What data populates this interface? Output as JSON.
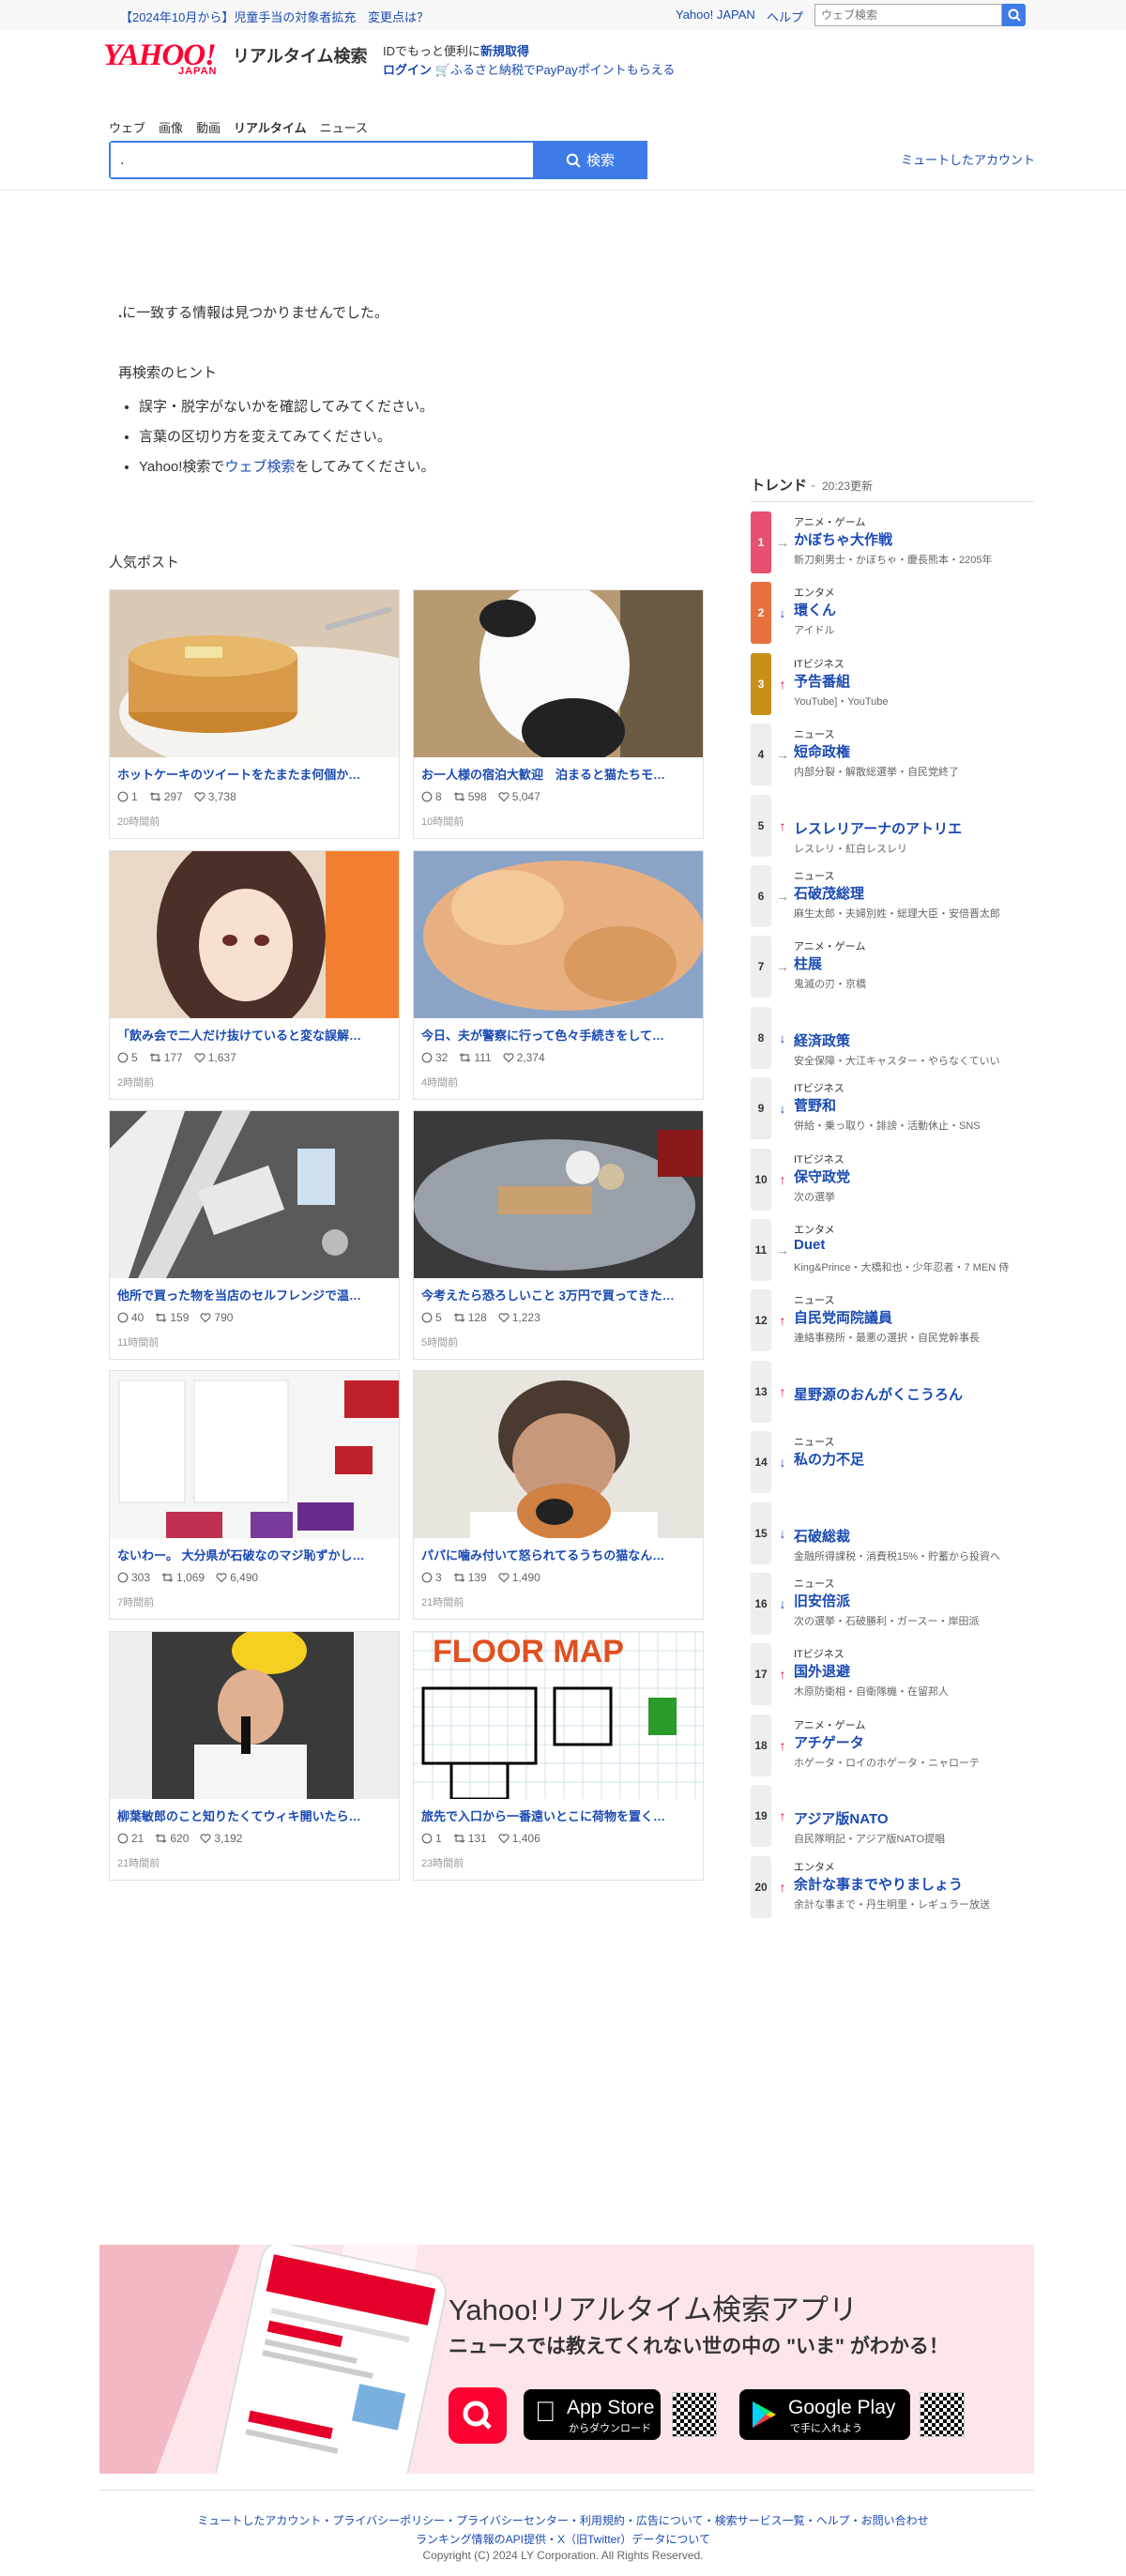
{
  "top_bar": {
    "notice": "【2024年10月から】児童手当の対象者拡充",
    "notice_link": "変更点は？",
    "yahoo_japan": "Yahoo! JAPAN",
    "help": "ヘルプ",
    "web_search_placeholder": "ウェブ検索"
  },
  "header": {
    "logo_text": "YAHOO!",
    "logo_sub": "JAPAN",
    "service_name": "リアルタイム検索",
    "login_text_prefix": "IDでもっと便利に",
    "signup": "新規取得",
    "login": "ログイン",
    "furusato": "ふるさと納税でPayPayポイントもらえる"
  },
  "tabs": [
    {
      "label": "ウェブ"
    },
    {
      "label": "画像"
    },
    {
      "label": "動画"
    },
    {
      "label": "リアルタイム",
      "active": true
    },
    {
      "label": "ニュース"
    }
  ],
  "search": {
    "query": ".",
    "button_label": "検索"
  },
  "muted_accounts": "ミュートしたアカウント",
  "no_result": {
    "query": ".",
    "message": "に一致する情報は見つかりませんでした。",
    "hint_title": "再検索のヒント",
    "hints": [
      "誤字・脱字がないかを確認してみてください。",
      "言葉の区切り方を変えてみてください。"
    ],
    "hint3_prefix": "Yahoo!検索で",
    "hint3_link": "ウェブ検索",
    "hint3_suffix": "をしてみてください。"
  },
  "popular": {
    "title": "人気ポスト",
    "posts": [
      {
        "title": "ホットケーキのツイートをたまたま何個か…",
        "replies": "1",
        "reposts": "297",
        "likes": "3,738",
        "time": "20時間前",
        "thumb": "pancake"
      },
      {
        "title": "お一人様の宿泊大歓迎　泊まると猫たちモ…",
        "replies": "8",
        "reposts": "598",
        "likes": "5,047",
        "time": "10時間前",
        "thumb": "cat-bw"
      },
      {
        "title": "「飲み会で二人だけ抜けていると変な誤解…",
        "replies": "5",
        "reposts": "177",
        "likes": "1,637",
        "time": "2時間前",
        "thumb": "anime"
      },
      {
        "title": "今日、夫が警察に行って色々手続きをして…",
        "replies": "32",
        "reposts": "111",
        "likes": "2,374",
        "time": "4時間前",
        "thumb": "cat-orange"
      },
      {
        "title": "他所で買った物を当店のセルフレンジで温…",
        "replies": "40",
        "reposts": "159",
        "likes": "790",
        "time": "11時間前",
        "thumb": "trash"
      },
      {
        "title": "今考えたら恐ろしいこと 3万円で買ってきた…",
        "replies": "5",
        "reposts": "128",
        "likes": "1,223",
        "time": "5時間前",
        "thumb": "car"
      },
      {
        "title": "ないわー。 大分県が石破なのマジ恥ずかし…",
        "replies": "303",
        "reposts": "1,069",
        "likes": "6,490",
        "time": "7時間前",
        "thumb": "map"
      },
      {
        "title": "パパに噛み付いて怒られてるうちの猫なん…",
        "replies": "3",
        "reposts": "139",
        "likes": "1,490",
        "time": "21時間前",
        "thumb": "man-cat"
      },
      {
        "title": "柳葉敏郎のこと知りたくてウィキ開いたら…",
        "replies": "21",
        "reposts": "620",
        "likes": "3,192",
        "time": "21時間前",
        "thumb": "baseball"
      },
      {
        "title": "旅先で入口から一番遠いとこに荷物を置く…",
        "replies": "1",
        "reposts": "131",
        "likes": "1,406",
        "time": "23時間前",
        "thumb": "floormap"
      }
    ]
  },
  "trends": {
    "title": "トレンド",
    "updated": "20:23更新",
    "items": [
      {
        "rank": "1",
        "dir": "flat",
        "category": "アニメ・ゲーム",
        "word": "かぼちゃ大作戦",
        "related": "新刀剣男士・かぼちゃ・慶長熊本・2205年",
        "color": "#e8506f"
      },
      {
        "rank": "2",
        "dir": "down",
        "category": "エンタメ",
        "word": "環くん",
        "related": "アイドル",
        "color": "#e8703c"
      },
      {
        "rank": "3",
        "dir": "up",
        "category": "ITビジネス",
        "word": "予告番組",
        "related": "YouTube]・YouTube",
        "color": "#c8901a"
      },
      {
        "rank": "4",
        "dir": "flat",
        "category": "ニュース",
        "word": "短命政権",
        "related": "内部分裂・解散総選挙・自民党終了"
      },
      {
        "rank": "5",
        "dir": "up",
        "category": "",
        "word": "レスレリアーナのアトリエ",
        "related": "レスレリ・紅白レスレリ"
      },
      {
        "rank": "6",
        "dir": "flat",
        "category": "ニュース",
        "word": "石破茂総理",
        "related": "麻生太郎・夫婦別姓・総理大臣・安倍晋太郎"
      },
      {
        "rank": "7",
        "dir": "flat",
        "category": "アニメ・ゲーム",
        "word": "柱展",
        "related": "鬼滅の刃・京橋"
      },
      {
        "rank": "8",
        "dir": "down",
        "category": "",
        "word": "経済政策",
        "related": "安全保障・大江キャスター・やらなくていい"
      },
      {
        "rank": "9",
        "dir": "down",
        "category": "ITビジネス",
        "word": "菅野和",
        "related": "併給・乗っ取り・誹謗・活動休止・SNS"
      },
      {
        "rank": "10",
        "dir": "up",
        "category": "ITビジネス",
        "word": "保守政党",
        "related": "次の選挙"
      },
      {
        "rank": "11",
        "dir": "flat",
        "category": "エンタメ",
        "word": "Duet",
        "related": "King&Prince・大橋和也・少年忍者・7 MEN 侍"
      },
      {
        "rank": "12",
        "dir": "up",
        "category": "ニュース",
        "word": "自民党両院議員",
        "related": "連絡事務所・最悪の選択・自民党幹事長"
      },
      {
        "rank": "13",
        "dir": "up",
        "category": "",
        "word": "星野源のおんがくこうろん",
        "related": ""
      },
      {
        "rank": "14",
        "dir": "down",
        "category": "ニュース",
        "word": "私の力不足",
        "related": ""
      },
      {
        "rank": "15",
        "dir": "down",
        "category": "",
        "word": "石破総裁",
        "related": "金融所得課税・消費税15%・貯蓄から投資へ"
      },
      {
        "rank": "16",
        "dir": "down",
        "category": "ニュース",
        "word": "旧安倍派",
        "related": "次の選挙・石破勝利・ガースー・岸田派"
      },
      {
        "rank": "17",
        "dir": "up",
        "category": "ITビジネス",
        "word": "国外退避",
        "related": "木原防衛相・自衛隊機・在留邦人"
      },
      {
        "rank": "18",
        "dir": "up",
        "category": "アニメ・ゲーム",
        "word": "アチゲータ",
        "related": "ホゲータ・ロイのホゲータ・ニャローテ"
      },
      {
        "rank": "19",
        "dir": "up",
        "category": "",
        "word": "アジア版NATO",
        "related": "自民隊明記・アジア版NATO提唱"
      },
      {
        "rank": "20",
        "dir": "up",
        "category": "エンタメ",
        "word": "余計な事までやりましょう",
        "related": "余計な事まで・丹生明里・レギュラー放送"
      }
    ]
  },
  "banner": {
    "title": "Yahoo!リアルタイム検索アプリ",
    "subtitle": "ニュースでは教えてくれない世の中の \"いま\" がわかる！",
    "appstore_small": "",
    "appstore_big": "App Store",
    "appstore_sub": "からダウンロード",
    "gplay_big": "Google Play",
    "gplay_sub": "で手に入れよう"
  },
  "footer": {
    "line1": "ミュートしたアカウント・プライバシーポリシー・プライバシーセンター・利用規約・広告について・検索サービス一覧・ヘルプ・お問い合わせ",
    "line2": "ランキング情報のAPI提供・X（旧Twitter）データについて",
    "copyright": "Copyright (C) 2024 LY Corporation. All Rights Reserved."
  }
}
